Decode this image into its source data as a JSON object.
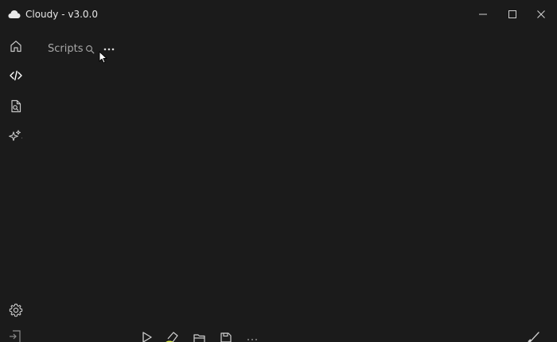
{
  "window": {
    "title": "Cloudy - v3.0.0",
    "background": "#1b1b1b"
  },
  "titlebar": {
    "controls": [
      {
        "name": "minimize-icon"
      },
      {
        "name": "maximize-icon"
      },
      {
        "name": "close-icon"
      }
    ]
  },
  "sidebar": {
    "items": [
      {
        "name": "home-icon",
        "active": false
      },
      {
        "name": "code-icon",
        "active": true
      },
      {
        "name": "file-search-icon",
        "active": false
      },
      {
        "name": "sparkle-icon",
        "active": false
      }
    ],
    "footer": {
      "name": "gear-icon"
    }
  },
  "main": {
    "header": {
      "label": "Scripts",
      "actions": [
        {
          "name": "search-icon"
        },
        {
          "name": "more-options-icon"
        }
      ]
    }
  },
  "bottom_toolbar": {
    "items": [
      {
        "name": "import-icon"
      },
      {
        "name": "play-icon"
      },
      {
        "name": "eraser-icon"
      },
      {
        "name": "folder-open-icon"
      },
      {
        "name": "save-icon"
      },
      {
        "name": "more-icon"
      },
      {
        "name": "brush-icon"
      }
    ]
  },
  "colors": {
    "icon": "#c8c8c8",
    "icon_active": "#ffffff",
    "text_muted": "#a9a9a9",
    "accent": "#d6e64a"
  }
}
